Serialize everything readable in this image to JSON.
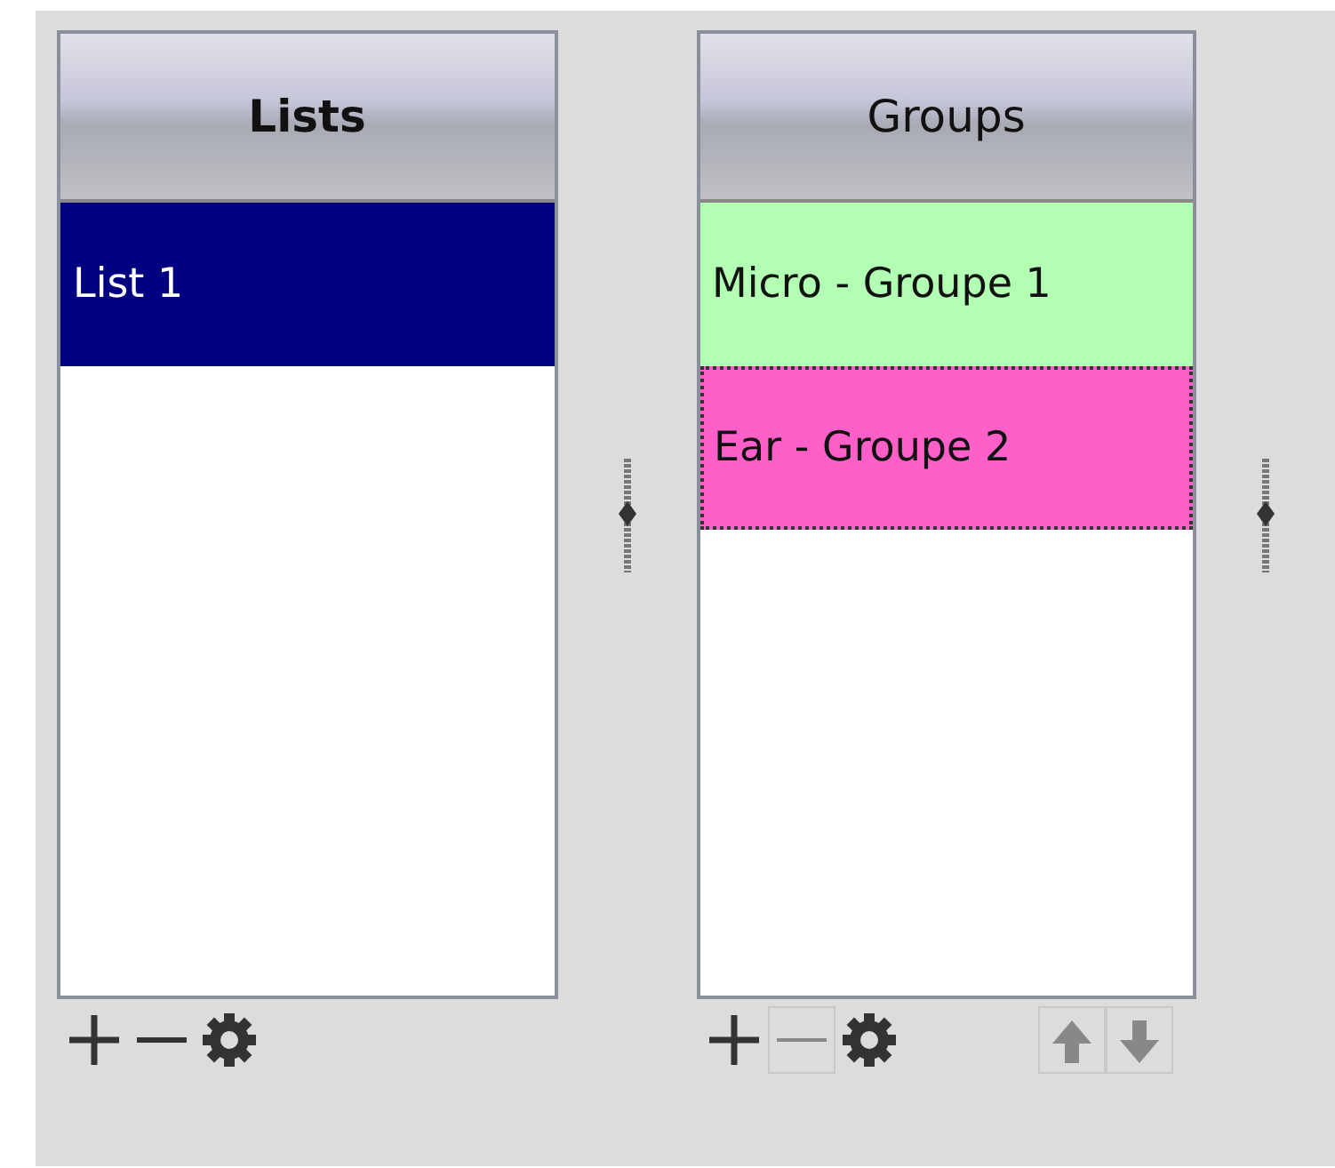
{
  "panels": [
    {
      "header": "Lists",
      "header_active": true,
      "items": [
        {
          "label": "List 1",
          "selected": true,
          "focused": false
        }
      ],
      "buttons": [
        {
          "kind": "add",
          "disabled": false
        },
        {
          "kind": "remove",
          "disabled": false
        },
        {
          "kind": "settings",
          "disabled": false
        }
      ]
    },
    {
      "header": "Groups",
      "header_active": false,
      "items": [
        {
          "label": "Micro - Groupe 1",
          "selected": false,
          "focused": false,
          "color": "#b3ffb3"
        },
        {
          "label": "Ear - Groupe 2",
          "selected": false,
          "focused": true,
          "color": "#ff5fc8"
        }
      ],
      "buttons": [
        {
          "kind": "add",
          "disabled": false
        },
        {
          "kind": "remove",
          "disabled": true
        },
        {
          "kind": "settings",
          "disabled": false
        },
        {
          "kind": "up",
          "disabled": true
        },
        {
          "kind": "down",
          "disabled": true
        }
      ]
    }
  ]
}
